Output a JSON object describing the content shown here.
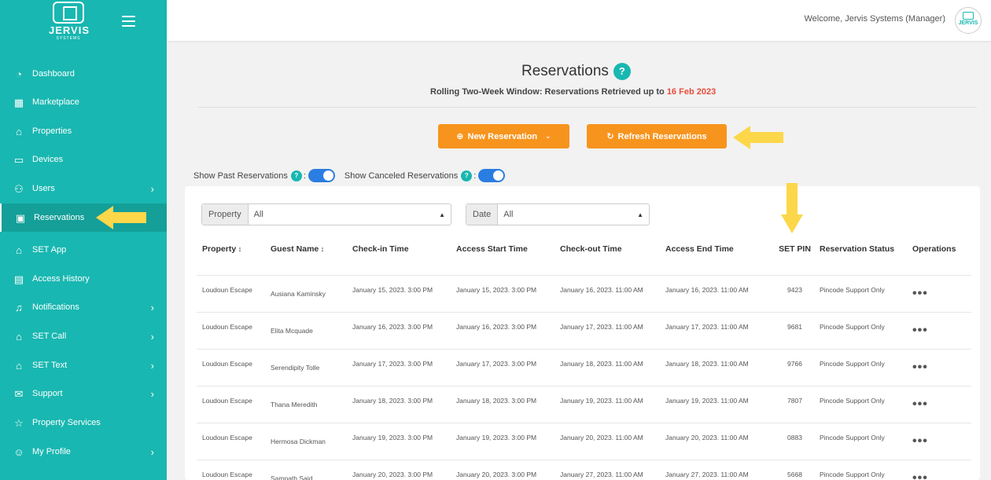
{
  "sidebar": {
    "logo_text": "JERVIS",
    "logo_sub": "SYSTEMS",
    "items": [
      {
        "label": "Dashboard",
        "icon": "gauge-icon",
        "has_chevron": false
      },
      {
        "label": "Marketplace",
        "icon": "store-icon",
        "has_chevron": false
      },
      {
        "label": "Properties",
        "icon": "home-icon",
        "has_chevron": false
      },
      {
        "label": "Devices",
        "icon": "laptop-icon",
        "has_chevron": false
      },
      {
        "label": "Users",
        "icon": "user-icon",
        "has_chevron": true
      },
      {
        "label": "Reservations",
        "icon": "calendar-icon",
        "has_chevron": false,
        "active": true
      },
      {
        "label": "SET App",
        "icon": "home-icon",
        "has_chevron": false
      },
      {
        "label": "Access History",
        "icon": "clipboard-icon",
        "has_chevron": false
      },
      {
        "label": "Notifications",
        "icon": "bell-icon",
        "has_chevron": true
      },
      {
        "label": "SET Call",
        "icon": "home-icon",
        "has_chevron": true
      },
      {
        "label": "SET Text",
        "icon": "home-icon",
        "has_chevron": true
      },
      {
        "label": "Support",
        "icon": "envelope-icon",
        "has_chevron": true
      },
      {
        "label": "Property Services",
        "icon": "star-icon",
        "has_chevron": false
      },
      {
        "label": "My Profile",
        "icon": "profile-icon",
        "has_chevron": true
      }
    ]
  },
  "header": {
    "welcome": "Welcome, Jervis Systems (Manager)",
    "avatar_text": "JERVIS"
  },
  "page": {
    "title": "Reservations",
    "help": "?",
    "subtitle_prefix": "Rolling Two-Week Window: Reservations Retrieved up to ",
    "subtitle_date": "16 Feb 2023"
  },
  "buttons": {
    "new_reservation": "New Reservation",
    "refresh_reservations": "Refresh Reservations"
  },
  "toggles": {
    "show_past": "Show Past Reservations",
    "show_canceled": "Show Canceled Reservations",
    "help": "?",
    "colon": ":"
  },
  "filters": {
    "property_label": "Property",
    "property_value": "All",
    "date_label": "Date",
    "date_value": "All"
  },
  "table": {
    "headers": [
      "Property",
      "Guest Name",
      "Check-in Time",
      "Access Start Time",
      "Check-out Time",
      "Access End Time",
      "SET PIN",
      "Reservation Status",
      "Operations"
    ],
    "rows": [
      {
        "property": "Loudoun Escape",
        "guest": "Ausiana Kaminsky",
        "checkin": "January 15, 2023. 3:00 PM",
        "access_start": "January 15, 2023. 3:00 PM",
        "checkout": "January 16, 2023. 11:00 AM",
        "access_end": "January 16, 2023. 11:00 AM",
        "pin": "9423",
        "status": "Pincode Support Only"
      },
      {
        "property": "Loudoun Escape",
        "guest": "Elita Mcquade",
        "checkin": "January 16, 2023. 3:00 PM",
        "access_start": "January 16, 2023. 3:00 PM",
        "checkout": "January 17, 2023. 11:00 AM",
        "access_end": "January 17, 2023. 11:00 AM",
        "pin": "9681",
        "status": "Pincode Support Only"
      },
      {
        "property": "Loudoun Escape",
        "guest": "Serendipity Tolle",
        "checkin": "January 17, 2023. 3:00 PM",
        "access_start": "January 17, 2023. 3:00 PM",
        "checkout": "January 18, 2023. 11:00 AM",
        "access_end": "January 18, 2023. 11:00 AM",
        "pin": "9766",
        "status": "Pincode Support Only"
      },
      {
        "property": "Loudoun Escape",
        "guest": "Thana Meredith",
        "checkin": "January 18, 2023. 3:00 PM",
        "access_start": "January 18, 2023. 3:00 PM",
        "checkout": "January 19, 2023. 11:00 AM",
        "access_end": "January 19, 2023. 11:00 AM",
        "pin": "7807",
        "status": "Pincode Support Only"
      },
      {
        "property": "Loudoun Escape",
        "guest": "Hermosa Dickman",
        "checkin": "January 19, 2023. 3:00 PM",
        "access_start": "January 19, 2023. 3:00 PM",
        "checkout": "January 20, 2023. 11:00 AM",
        "access_end": "January 20, 2023. 11:00 AM",
        "pin": "0883",
        "status": "Pincode Support Only"
      },
      {
        "property": "Loudoun Escape",
        "guest": "Sampath Said",
        "checkin": "January 20, 2023. 3:00 PM",
        "access_start": "January 20, 2023. 3:00 PM",
        "checkout": "January 27, 2023. 11:00 AM",
        "access_end": "January 27, 2023. 11:00 AM",
        "pin": "5668",
        "status": "Pincode Support Only"
      }
    ],
    "operations_glyph": "•••"
  },
  "colors": {
    "sidebar": "#19b7b1",
    "sidebar_active": "#149f99",
    "accent_orange": "#f7941d",
    "toggle_blue": "#2a7de1",
    "date_red": "#e74c3c",
    "annotation_yellow": "#fcd74a"
  }
}
